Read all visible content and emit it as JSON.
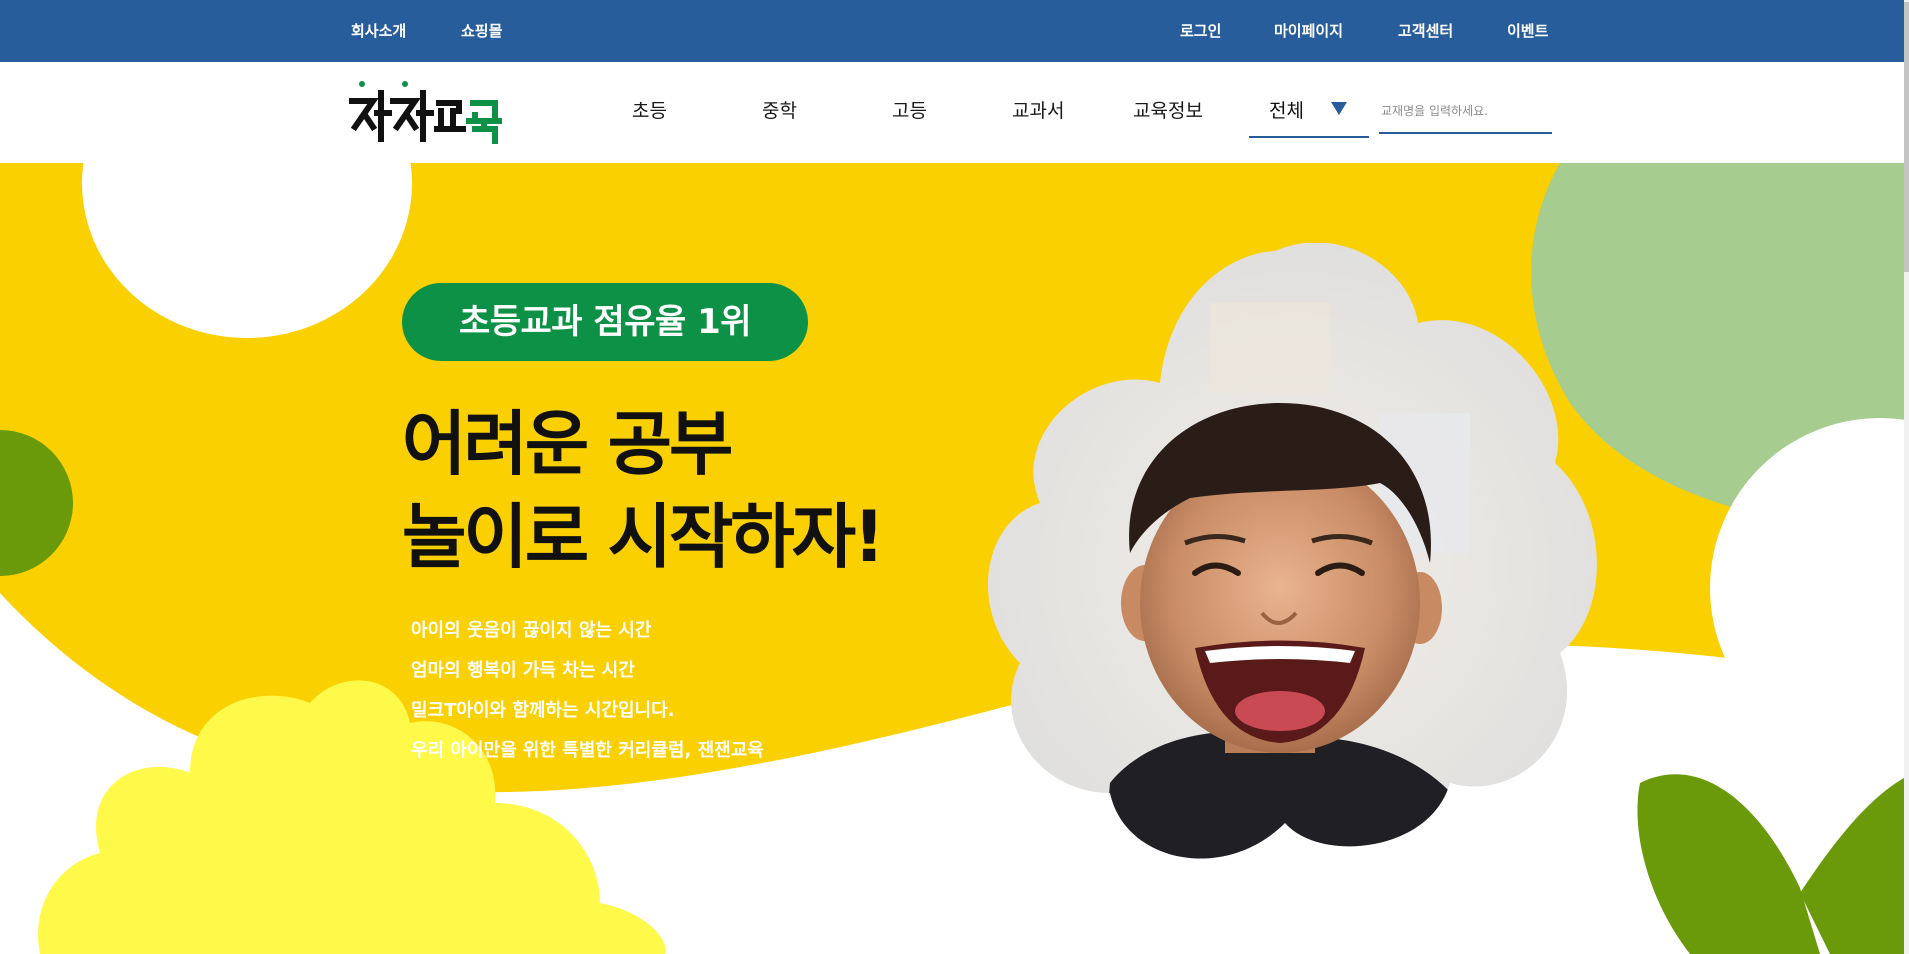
{
  "topbar": {
    "left_links": [
      "회사소개",
      "쇼핑몰"
    ],
    "right_links": [
      "로그인",
      "마이페이지",
      "고객센터",
      "이벤트"
    ]
  },
  "header": {
    "logo_text": "잰잰교육",
    "nav": [
      "초등",
      "중학",
      "고등",
      "교과서",
      "교육정보"
    ],
    "search_category": "전체",
    "search_placeholder": "교재명을 입력하세요."
  },
  "hero": {
    "badge": "초등교과 점유율 1위",
    "headline": [
      "어려운 공부",
      "놀이로 시작하자!"
    ],
    "description": [
      "아이의 웃음이 끊이지 않는 시간",
      "엄마의 행복이 가득 차는 시간",
      "밀크T아이와 함께하는 시간입니다.",
      "우리 아이만을 위한 특별한 커리큘럼, 잰잰교육"
    ]
  },
  "colors": {
    "topbar": "#285d9c",
    "hero_yellow": "#fad000",
    "badge_green": "#0c9146",
    "light_green": "#a6cc8f",
    "olive": "#6a9a0a",
    "pale_yellow": "#fff94a"
  }
}
